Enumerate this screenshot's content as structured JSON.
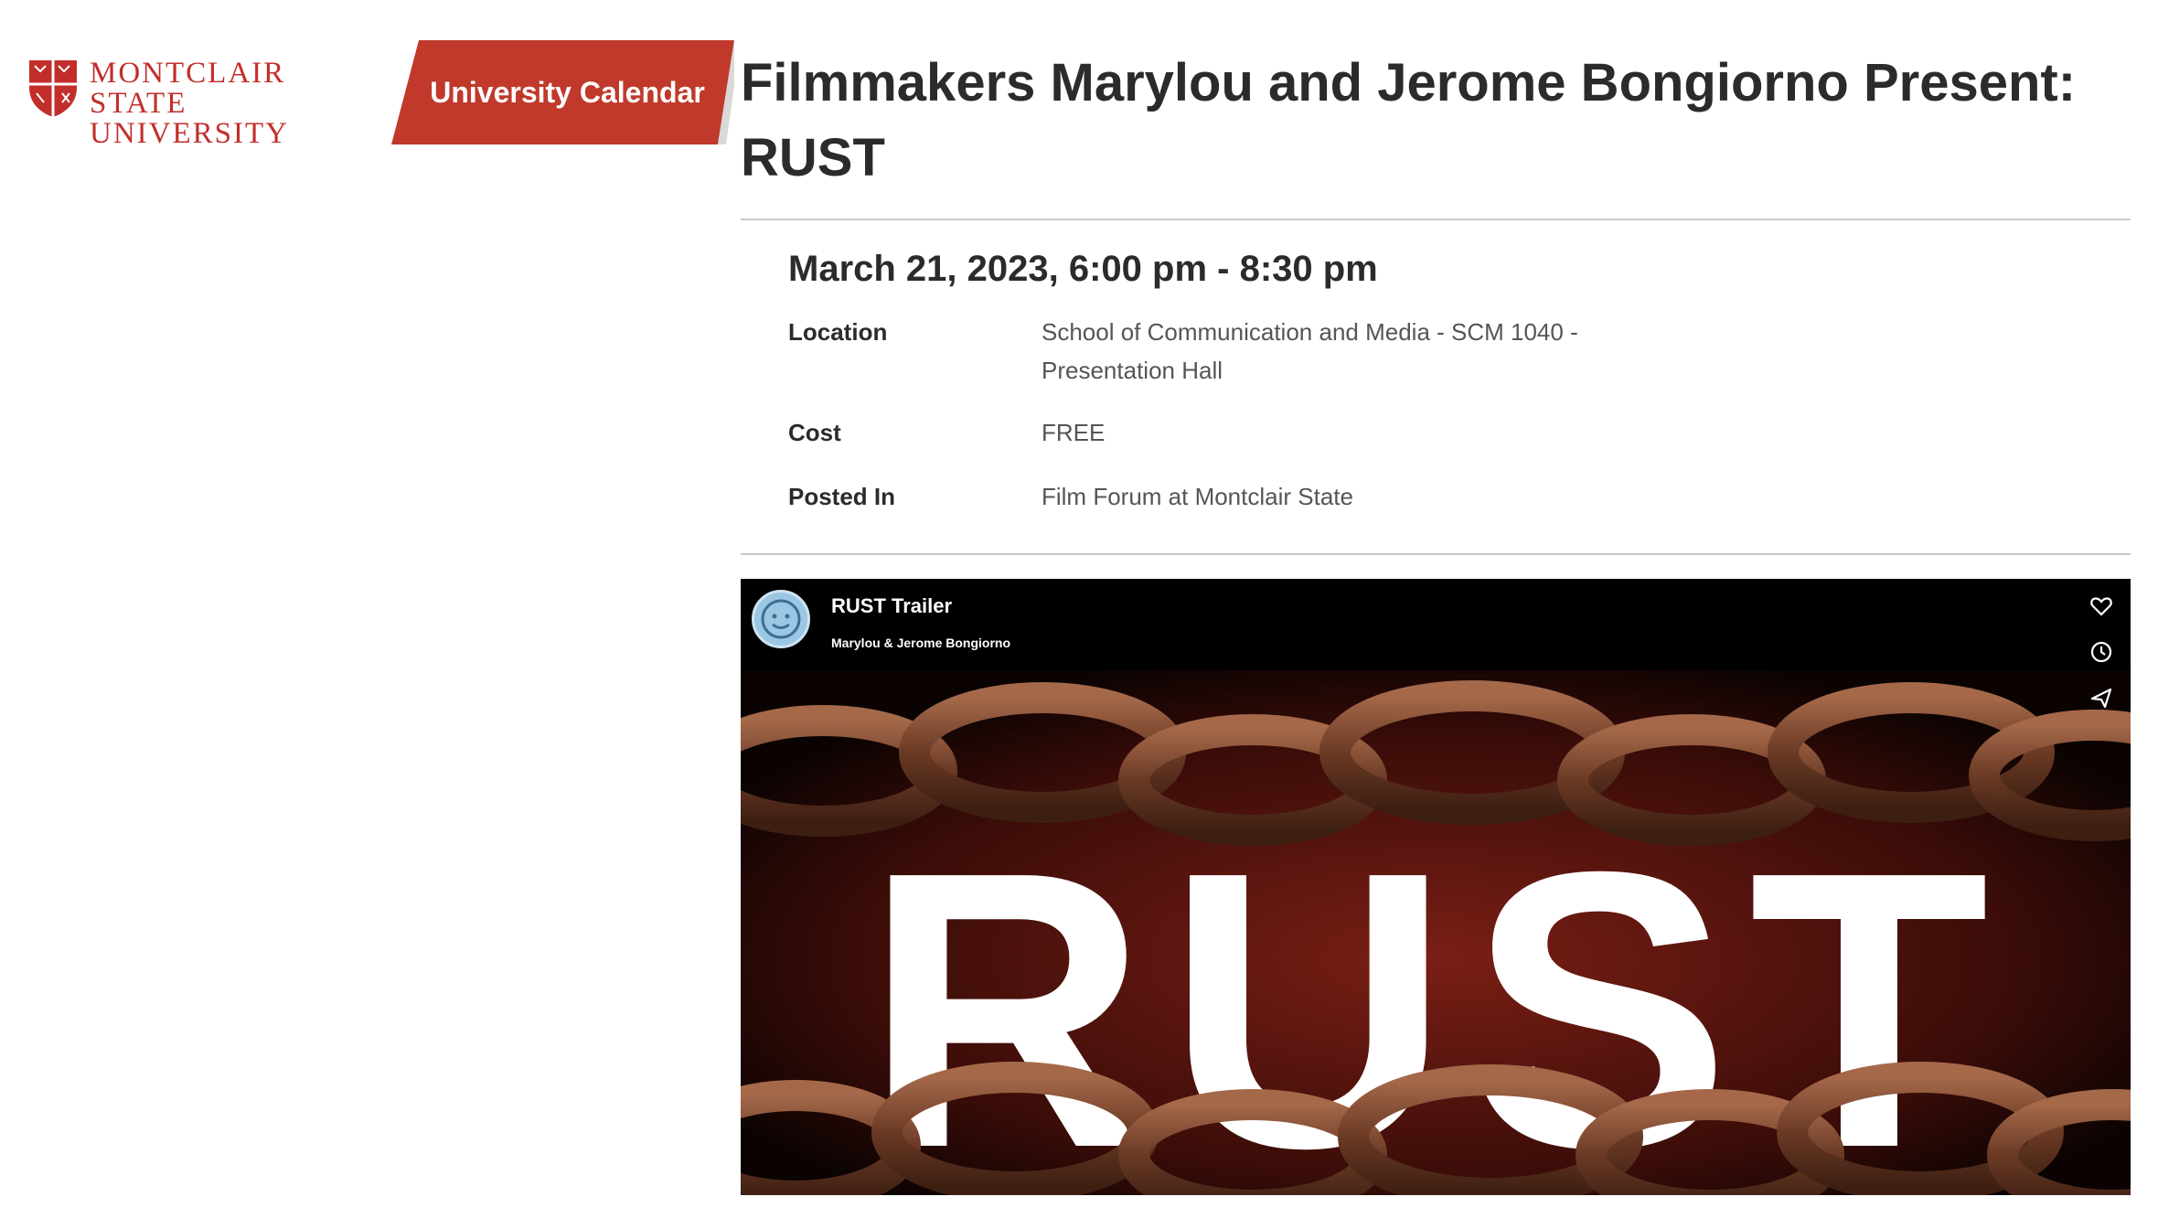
{
  "brand": {
    "wordmark_line1": "MONTCLAIR STATE",
    "wordmark_line2": "UNIVERSITY",
    "color": "#c22e2a"
  },
  "nav": {
    "calendar_label": "University Calendar",
    "tab_color": "#c0392b"
  },
  "event": {
    "title_line1": "Filmmakers Marylou and Jerome Bongiorno Present:",
    "title_line2": "RUST",
    "datetime": "March 21, 2023, 6:00 pm - 8:30 pm",
    "details": [
      {
        "label": "Location",
        "value_line1": "School of Communication and Media - SCM 1040 -",
        "value_line2": "Presentation Hall"
      },
      {
        "label": "Cost",
        "value_line1": "FREE"
      },
      {
        "label": "Posted In",
        "value_line1": "Film Forum at Montclair State"
      }
    ]
  },
  "video": {
    "title": "RUST Trailer",
    "byline": "Marylou & Jerome Bongiorno",
    "poster_text": "RUST",
    "icons": [
      "heart-icon",
      "clock-icon",
      "share-icon"
    ]
  }
}
